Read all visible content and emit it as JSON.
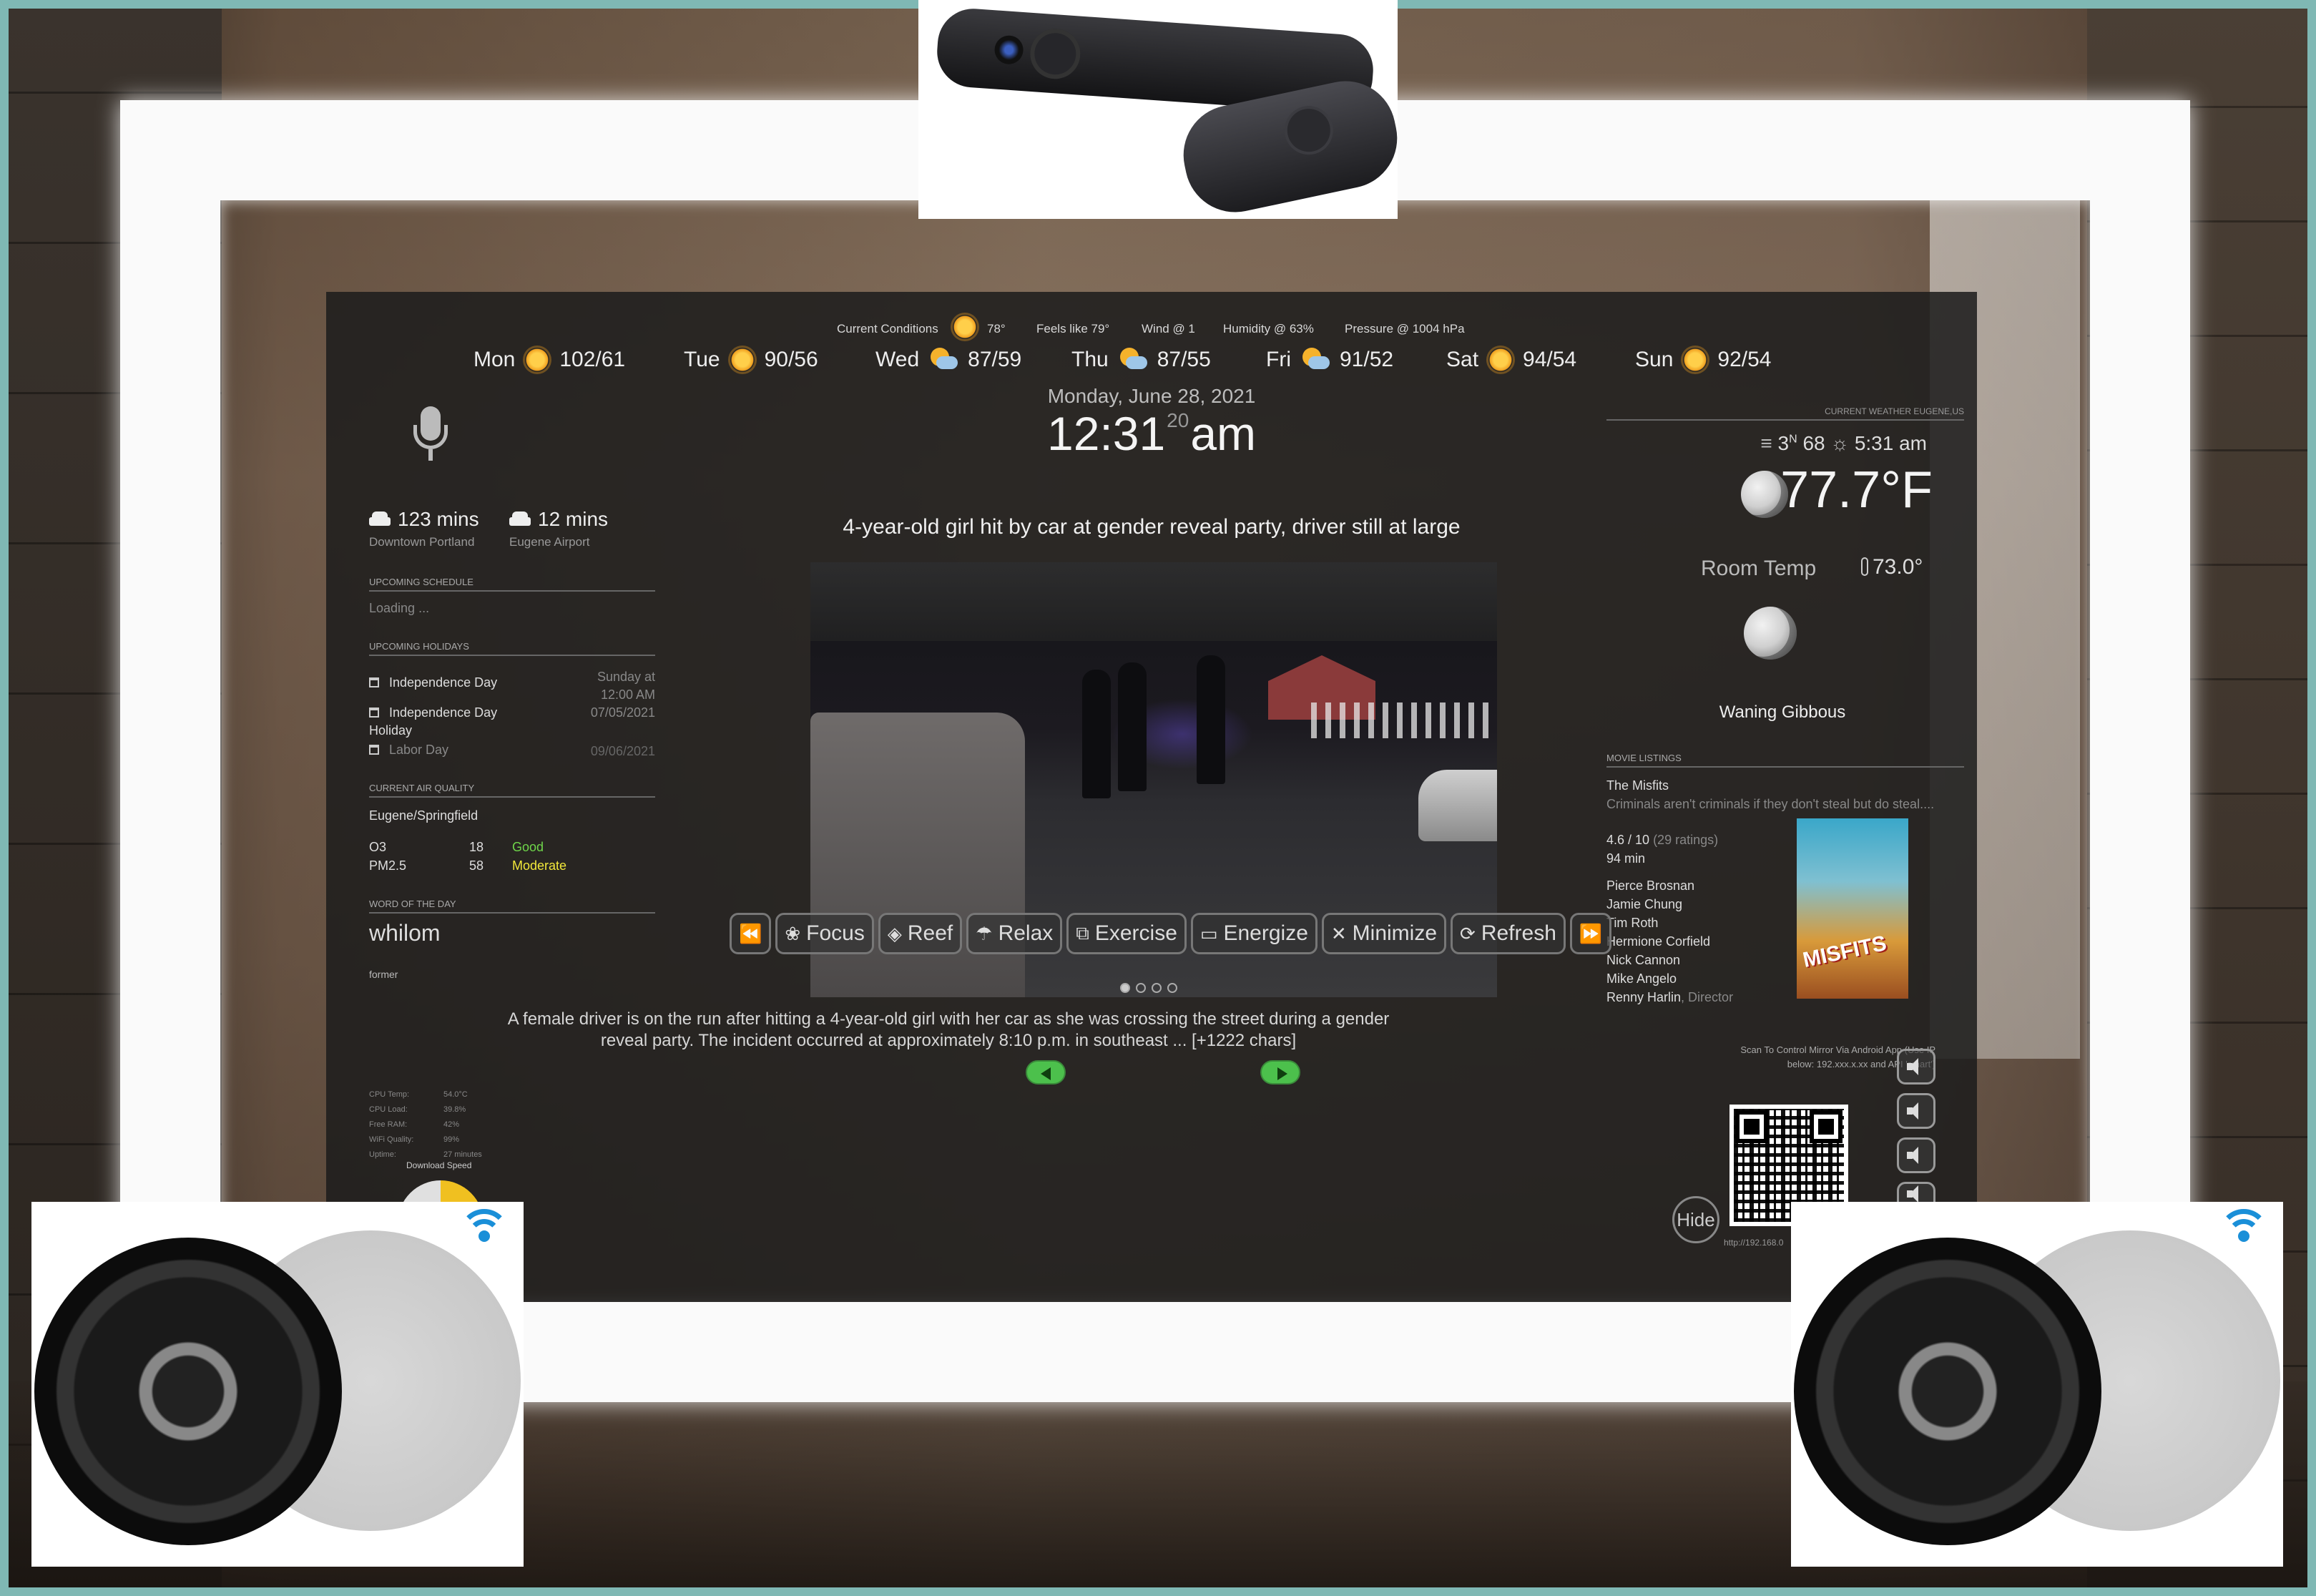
{
  "forecast": [
    {
      "day": "Mon",
      "temps": "102/61",
      "icon": "sunny-icon"
    },
    {
      "day": "Tue",
      "temps": "90/56",
      "icon": "sunny-icon"
    },
    {
      "day": "Wed",
      "temps": "87/59",
      "icon": "partly-cloudy-icon"
    },
    {
      "day": "Thu",
      "temps": "87/55",
      "icon": "partly-cloudy-icon"
    },
    {
      "day": "Fri",
      "temps": "91/52",
      "icon": "partly-cloudy-icon"
    },
    {
      "day": "Sat",
      "temps": "94/54",
      "icon": "sunny-icon"
    },
    {
      "day": "Sun",
      "temps": "92/54",
      "icon": "sunny-icon"
    }
  ],
  "current_conditions": {
    "label": "Current Conditions",
    "temp": "78°",
    "feels_like": "Feels like 79°",
    "wind": "Wind @ 1",
    "humidity": "Humidity @ 63%",
    "pressure": "Pressure @ 1004 hPa"
  },
  "clock": {
    "date": "Monday, June 28, 2021",
    "hour_min": "12:31",
    "seconds": "20",
    "ampm": "am"
  },
  "travel": [
    {
      "time": "123 mins",
      "destination": "Downtown Portland"
    },
    {
      "time": "12 mins",
      "destination": "Eugene Airport"
    }
  ],
  "schedule": {
    "title": "UPCOMING SCHEDULE",
    "status": "Loading ..."
  },
  "holidays": {
    "title": "UPCOMING HOLIDAYS",
    "items": [
      {
        "name": "Independence Day",
        "when": "Sunday at 12:00 AM"
      },
      {
        "name": "Independence Day Holiday",
        "when": "07/05/2021"
      },
      {
        "name": "Labor Day",
        "when": "09/06/2021"
      }
    ]
  },
  "air_quality": {
    "title": "CURRENT AIR QUALITY",
    "location": "Eugene/Springfield",
    "rows": [
      {
        "pollutant": "O3",
        "value": "18",
        "rating": "Good"
      },
      {
        "pollutant": "PM2.5",
        "value": "58",
        "rating": "Moderate"
      }
    ]
  },
  "word_of_day": {
    "title": "WORD OF THE DAY",
    "word": "whilom",
    "definition": "former"
  },
  "system_stats": [
    {
      "label": "CPU Temp:",
      "value": "54.0°C"
    },
    {
      "label": "CPU Load:",
      "value": "39.8%"
    },
    {
      "label": "Free RAM:",
      "value": "42%"
    },
    {
      "label": "WiFi Quality:",
      "value": "99%"
    },
    {
      "label": "Uptime:",
      "value": "27 minutes"
    }
  ],
  "download_label": "Download Speed",
  "news": {
    "headline": "4-year-old girl hit by car at gender reveal party, driver still at large",
    "description": "A female driver is on the run after hitting a 4-year-old girl with her car as she was crossing the street during a gender reveal party. The incident occurred at approximately 8:10 p.m. in southeast ... [+1222 chars]"
  },
  "weather": {
    "header": "CURRENT WEATHER EUGENE,US",
    "wind": "3",
    "wind_dir": "N",
    "humidity": "68",
    "sunrise": "5:31 am",
    "temperature": "77.7°F",
    "room_label": "Room Temp",
    "room_temp": "73.0°",
    "moon_phase": "Waning Gibbous"
  },
  "movies": {
    "title": "MOVIE LISTINGS",
    "name": "The Misfits",
    "tagline": "Criminals aren't criminals if they don't steal but do steal....",
    "rating": "4.6 / 10",
    "rating_count": "(29 ratings)",
    "runtime": "94 min",
    "cast": [
      "Pierce Brosnan",
      "Jamie Chung",
      "Tim Roth",
      "Hermione Corfield",
      "Nick Cannon",
      "Mike Angelo"
    ],
    "director": "Renny Harlin",
    "director_label": ", Director",
    "poster_text": "MISFITS"
  },
  "remote_control": {
    "instructions": "Scan To Control Mirror Via Android App (Use IP below: 192.xxx.x.xx and API 'smart')",
    "url": "http://192.168.0",
    "hide_label": "Hide"
  },
  "volume_buttons": [
    "volume-up-icon",
    "volume-down-icon",
    "volume-mute-icon",
    "volume-icon"
  ],
  "controls": [
    {
      "label": "",
      "icon": "rewind-icon",
      "glyph": "⏪"
    },
    {
      "label": "Focus",
      "icon": "lotus-icon",
      "glyph": "❀"
    },
    {
      "label": "Reef",
      "icon": "fish-icon",
      "glyph": "◈"
    },
    {
      "label": "Relax",
      "icon": "umbrella-beach-icon",
      "glyph": "☂"
    },
    {
      "label": "Exercise",
      "icon": "dumbbell-icon",
      "glyph": "⧉"
    },
    {
      "label": "Energize",
      "icon": "battery-icon",
      "glyph": "▭"
    },
    {
      "label": "Minimize",
      "icon": "compress-icon",
      "glyph": "✕"
    },
    {
      "label": "Refresh",
      "icon": "sync-icon",
      "glyph": "⟳"
    },
    {
      "label": "",
      "icon": "fast-forward-icon",
      "glyph": "⏩"
    }
  ],
  "page_dots": {
    "count": 4,
    "active": 0
  }
}
